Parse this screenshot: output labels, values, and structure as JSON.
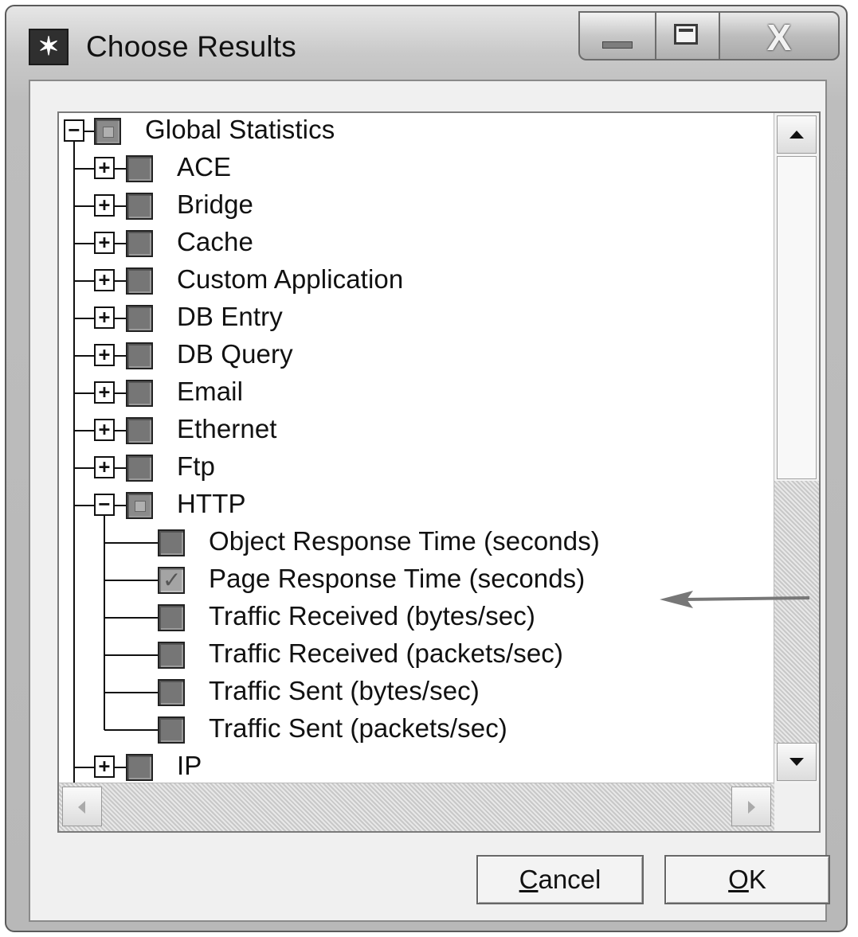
{
  "window": {
    "title": "Choose Results",
    "close_glyph": "X"
  },
  "tree": {
    "root": {
      "label": "Global Statistics",
      "expanded": true,
      "state": "partial"
    },
    "items": [
      {
        "label": "ACE",
        "expanded": false,
        "state": "unchecked"
      },
      {
        "label": "Bridge",
        "expanded": false,
        "state": "unchecked"
      },
      {
        "label": "Cache",
        "expanded": false,
        "state": "unchecked"
      },
      {
        "label": "Custom Application",
        "expanded": false,
        "state": "unchecked"
      },
      {
        "label": "DB Entry",
        "expanded": false,
        "state": "unchecked"
      },
      {
        "label": "DB Query",
        "expanded": false,
        "state": "unchecked"
      },
      {
        "label": "Email",
        "expanded": false,
        "state": "unchecked"
      },
      {
        "label": "Ethernet",
        "expanded": false,
        "state": "unchecked"
      },
      {
        "label": "Ftp",
        "expanded": false,
        "state": "unchecked"
      },
      {
        "label": "HTTP",
        "expanded": true,
        "state": "partial",
        "children": [
          {
            "label": "Object Response Time (seconds)",
            "state": "unchecked"
          },
          {
            "label": "Page Response Time (seconds)",
            "state": "checked"
          },
          {
            "label": "Traffic Received (bytes/sec)",
            "state": "unchecked"
          },
          {
            "label": "Traffic Received (packets/sec)",
            "state": "unchecked"
          },
          {
            "label": "Traffic Sent (bytes/sec)",
            "state": "unchecked"
          },
          {
            "label": "Traffic Sent (packets/sec)",
            "state": "unchecked"
          }
        ]
      },
      {
        "label": "IP",
        "expanded": false,
        "state": "unchecked"
      }
    ]
  },
  "buttons": {
    "cancel": {
      "mnemonic": "C",
      "rest": "ancel"
    },
    "ok": {
      "mnemonic": "O",
      "rest": "K"
    }
  },
  "icons": {
    "app": "star-icon",
    "minimize": "minimize-icon",
    "maximize": "maximize-icon",
    "close": "close-icon",
    "annotation": "arrow-left-icon"
  },
  "colors": {
    "checkbox_fill": "#767676",
    "window_frame": "#bdbdbd"
  }
}
